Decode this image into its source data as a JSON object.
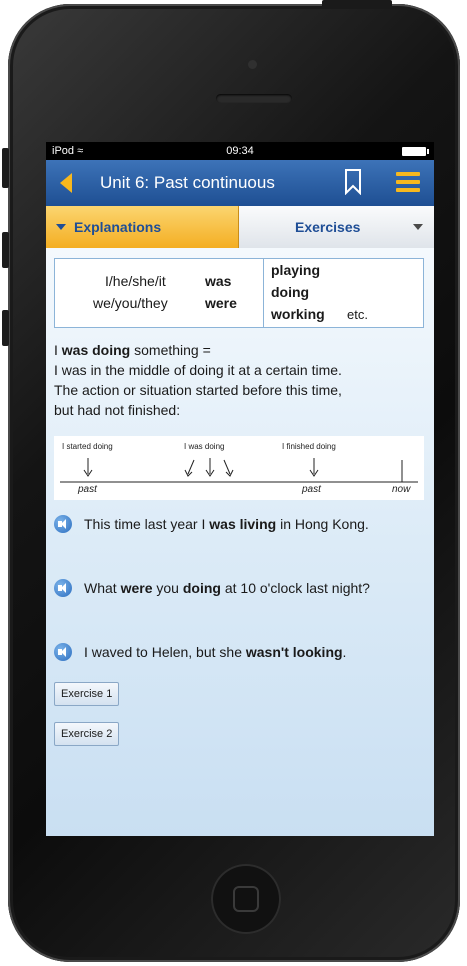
{
  "status": {
    "carrier": "iPod",
    "time": "09:34"
  },
  "nav": {
    "title": "Unit 6: Past continuous"
  },
  "tabs": {
    "explanations": "Explanations",
    "exercises": "Exercises"
  },
  "form_table": {
    "subjects_1": "I/he/she/it",
    "aux_1": "was",
    "subjects_2": "we/you/they",
    "aux_2": "were",
    "verbs": [
      "playing",
      "doing",
      "working"
    ],
    "etc": "etc."
  },
  "explanation": {
    "lead_bold": "was doing",
    "lead_prefix": "I ",
    "lead_suffix": " something =",
    "line_2": "I was in the middle of doing it at a certain time.",
    "line_3": "The action or situation started before this time,",
    "line_4": "but had not finished:"
  },
  "timeline": {
    "started": "I started doing",
    "was_doing": "I was doing",
    "finished": "I finished doing",
    "past_1": "past",
    "past_2": "past",
    "now": "now"
  },
  "examples": [
    {
      "pre": "This time last year I ",
      "bold": "was living",
      "post": " in Hong Kong."
    },
    {
      "pre": "What ",
      "bold": "were",
      "mid": " you ",
      "bold2": "doing",
      "post": " at 10 o'clock last night?"
    },
    {
      "pre": "I waved to Helen, but she ",
      "bold": "wasn't looking",
      "post": "."
    }
  ],
  "exercise_buttons": [
    "Exercise 1",
    "Exercise 2"
  ],
  "colors": {
    "nav_blue": "#1e4f93",
    "accent_yellow": "#f7b81e",
    "tab_blue_text": "#1f4e96"
  },
  "icons": [
    "back-arrow-icon",
    "bookmark-icon",
    "menu-icon",
    "speaker-icon"
  ]
}
